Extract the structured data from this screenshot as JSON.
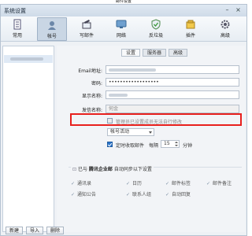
{
  "window": {
    "top_caption": "邮件设置",
    "title": "系统设置"
  },
  "toolbar": {
    "items": [
      {
        "label": "常用",
        "icon": "general-icon",
        "active": false
      },
      {
        "label": "帐号",
        "icon": "account-icon",
        "active": true
      },
      {
        "label": "写邮件",
        "icon": "compose-icon",
        "active": false
      },
      {
        "label": "网络",
        "icon": "network-icon",
        "active": false
      },
      {
        "label": "反垃圾",
        "icon": "antispam-icon",
        "active": false
      },
      {
        "label": "插件",
        "icon": "plugin-icon",
        "active": false
      },
      {
        "label": "高级",
        "icon": "advanced-icon",
        "active": false
      }
    ]
  },
  "tabs": [
    "设置",
    "服务器",
    "高级"
  ],
  "form": {
    "email_label": "Email地址:",
    "password_label": "密码:",
    "password_value": "••••••••••••••••••",
    "display_name_label": "显示名称:",
    "sender_name_label": "发信名称:",
    "sender_name_value": "何金",
    "admin_note": "管理员已设置成员无法自行修改",
    "status_select": "帐号活动",
    "schedule_prefix": "定时收取邮件",
    "schedule_every": "每隔",
    "schedule_value": "15",
    "schedule_unit": "分钟"
  },
  "sync": {
    "label_prefix": "已与",
    "label_bold": "腾讯企业邮",
    "label_suffix": "自动同步以下设置",
    "items": [
      "通讯录",
      "日历",
      "邮件标签",
      "邮件备注",
      "通知公告",
      "联系人组",
      "自动回复"
    ]
  },
  "bottom": {
    "new": "新建",
    "import": "导入",
    "delete": "删除"
  },
  "colors": {
    "highlight": "#e8201d",
    "accent": "#2b74c9"
  }
}
